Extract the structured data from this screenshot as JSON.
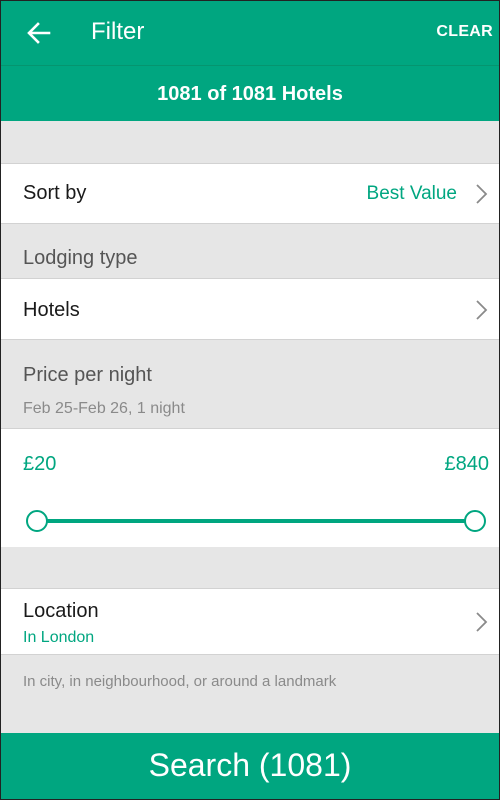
{
  "header": {
    "title": "Filter",
    "clear_label": "CLEAR"
  },
  "results": {
    "count_text": "1081 of 1081 Hotels"
  },
  "sort": {
    "label": "Sort by",
    "value": "Best Value"
  },
  "lodging": {
    "section_label": "Lodging type",
    "value": "Hotels"
  },
  "price": {
    "section_label": "Price per night",
    "dates": "Feb 25-Feb 26, 1 night",
    "min_label": "£20",
    "max_label": "£840",
    "range_min": 20,
    "range_max": 840,
    "selected_min": 20,
    "selected_max": 840
  },
  "location": {
    "label": "Location",
    "value": "In London",
    "hint": "In city, in neighbourhood, or around a landmark"
  },
  "footer": {
    "search_label": "Search (1081)"
  },
  "colors": {
    "accent": "#00a680"
  },
  "icons": {
    "back": "arrow-left-icon",
    "chevron": "chevron-right-icon"
  }
}
